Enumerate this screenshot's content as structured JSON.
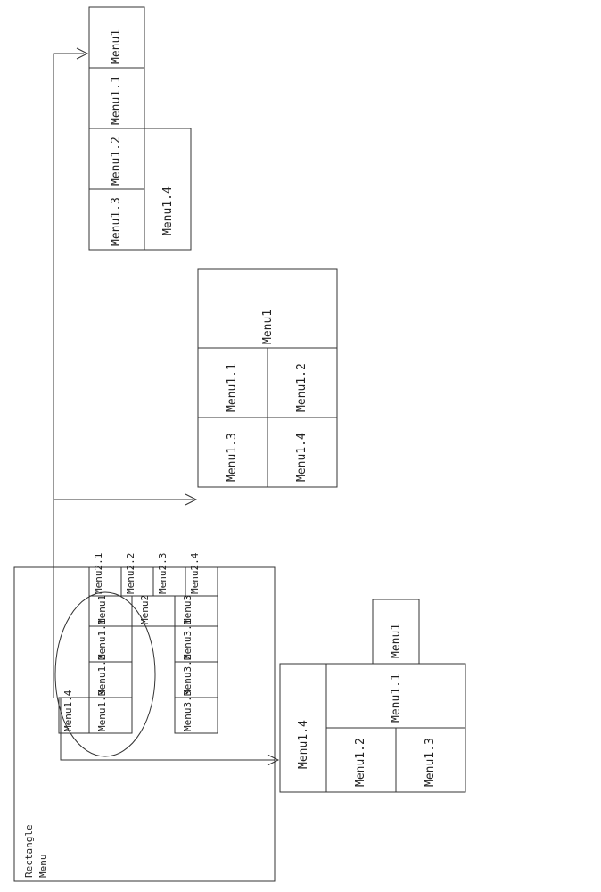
{
  "title_line1": "Rectangle",
  "title_line2": "Menu",
  "src": {
    "row1": [
      "Menu2.1",
      "Menu2.2",
      "Menu2.3",
      "Menu2.4"
    ],
    "row2": [
      "Menu1",
      "Menu2",
      "Menu3"
    ],
    "row3": [
      "Menu1.1",
      "",
      "Menu3.1"
    ],
    "row4": [
      "Menu1.2",
      "",
      "Menu3.2"
    ],
    "row5": [
      "Menu1.4",
      "Menu1.3",
      "",
      "Menu3.3"
    ]
  },
  "panelA": {
    "top": "Menu1",
    "r1": [
      "Menu1.4",
      "Menu1.1"
    ],
    "r2": [
      "Menu1.2",
      "Menu1.3"
    ]
  },
  "panelB": {
    "top": "Menu1",
    "r1": [
      "Menu1.1",
      "Menu1.2"
    ],
    "r2": [
      "Menu1.3",
      "Menu1.4"
    ]
  },
  "panelC": {
    "items": [
      "Menu1",
      "Menu1.1",
      "Menu1.2",
      "Menu1.3"
    ],
    "side": "Menu1.4"
  }
}
